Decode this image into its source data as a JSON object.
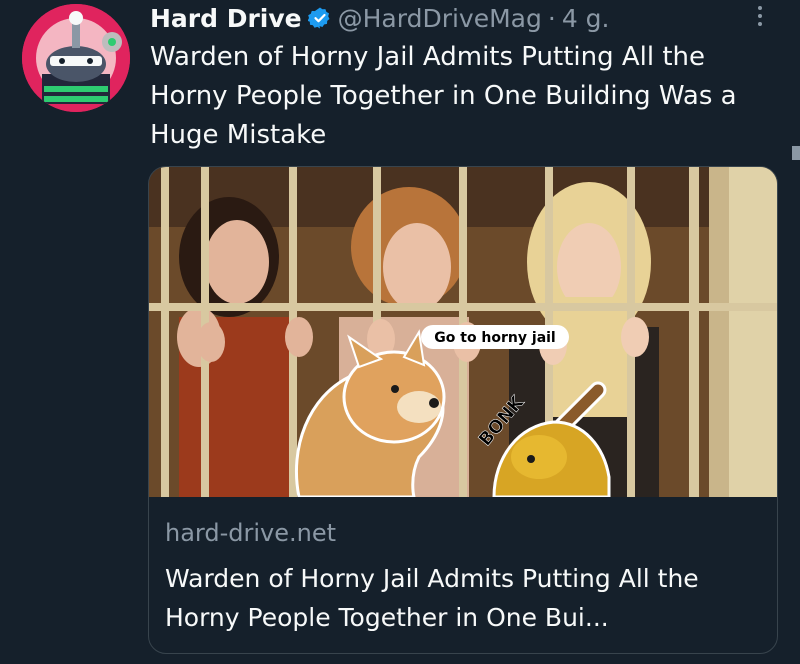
{
  "tweet": {
    "author_name": "Hard Drive",
    "handle": "@HardDriveMag",
    "separator": "·",
    "time": "4 g.",
    "text": "Warden of Horny Jail Admits Putting All the Horny People Together in One Building Was a Huge Mistake",
    "verified_icon": "verified-badge-icon",
    "more_icon": "more-options-icon"
  },
  "card": {
    "domain": "hard-drive.net",
    "title": "Warden of Horny Jail Admits Putting All the Horny People Together in One Bui...",
    "image": {
      "caption_speech": "Go to horny jail",
      "bonk_text": "BONK"
    }
  },
  "colors": {
    "background": "#15202b",
    "text_primary": "#f7f9f9",
    "text_secondary": "#8b98a5",
    "verified_blue": "#1d9bf0",
    "card_border": "#38444d"
  }
}
